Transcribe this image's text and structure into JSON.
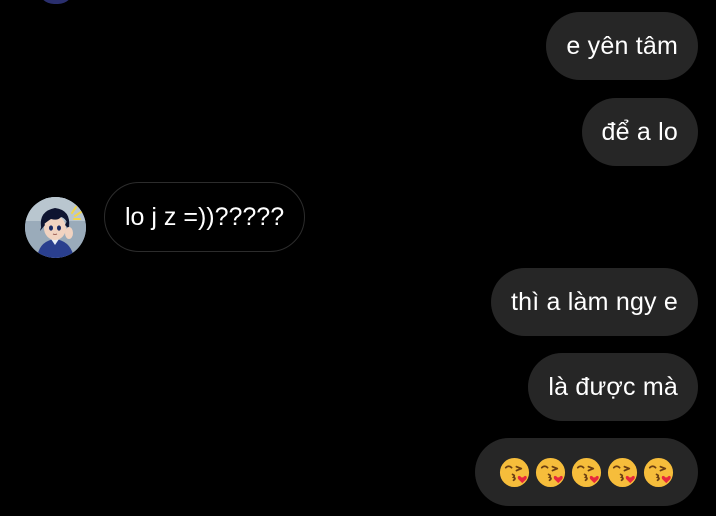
{
  "colors": {
    "background": "#000000",
    "outgoing_bubble": "#262626",
    "incoming_border": "#2c2c2c",
    "text": "#ffffff"
  },
  "messages": {
    "out_1": "e yên tâm",
    "out_2": "để a lo",
    "in_1": "lo j z =))?????",
    "out_3": "thì a làm ngy e",
    "out_4": "là được mà",
    "out_5_emoji": "face-throwing-a-kiss-icon"
  },
  "sender": {
    "avatar": "anime-boy-avatar-icon"
  }
}
